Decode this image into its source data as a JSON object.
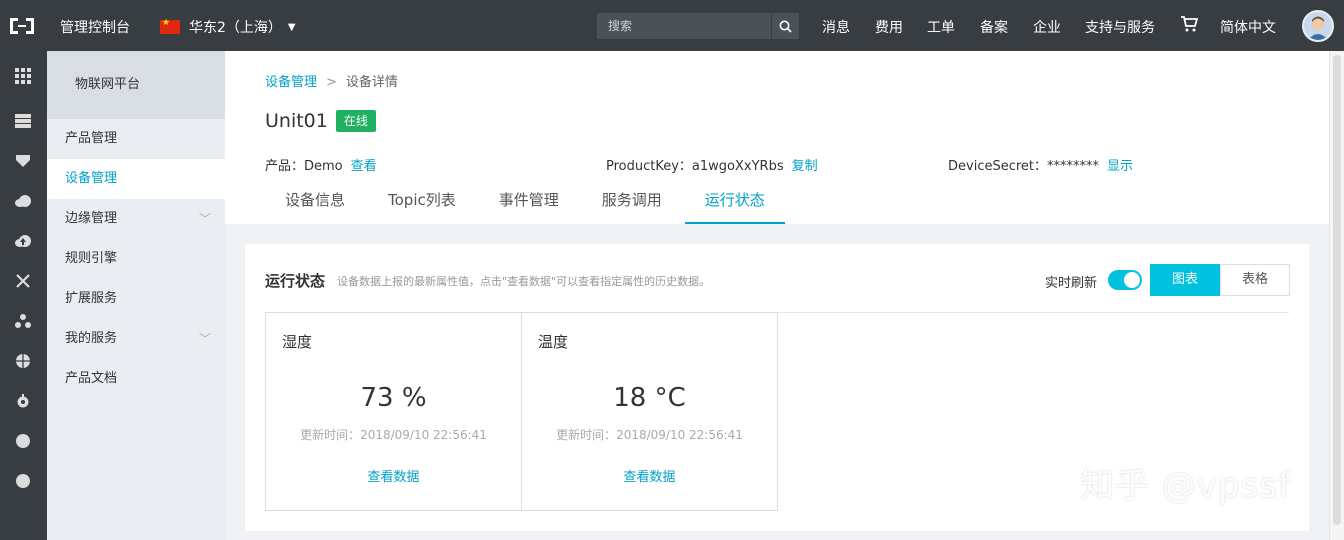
{
  "topbar": {
    "console_title": "管理控制台",
    "region": "华东2（上海）",
    "search_placeholder": "搜索",
    "nav": [
      "消息",
      "费用",
      "工单",
      "备案",
      "企业",
      "支持与服务"
    ],
    "language": "简体中文"
  },
  "iconbar": {
    "icons": [
      "grid-icon",
      "server-icon",
      "shield-icon",
      "cloud-icon",
      "cloud-upload-icon",
      "network-icon",
      "nodes-icon",
      "globe-icon",
      "gear-icon",
      "circle-icon",
      "circle-icon"
    ]
  },
  "sidebar": {
    "header": "物联网平台",
    "items": [
      {
        "label": "产品管理"
      },
      {
        "label": "设备管理"
      },
      {
        "label": "边缘管理"
      },
      {
        "label": "规则引擎"
      },
      {
        "label": "扩展服务"
      },
      {
        "label": "我的服务"
      },
      {
        "label": "产品文档"
      }
    ]
  },
  "breadcrumb": {
    "parent": "设备管理",
    "current": "设备详情"
  },
  "device": {
    "name": "Unit01",
    "status": "在线",
    "product_label": "产品：Demo",
    "product_link": "查看",
    "productkey_label": "ProductKey：a1wgoXxYRbs",
    "productkey_link": "复制",
    "secret_label": "DeviceSecret：********",
    "secret_link": "显示"
  },
  "tabs": [
    "设备信息",
    "Topic列表",
    "事件管理",
    "服务调用",
    "运行状态"
  ],
  "panel": {
    "title": "运行状态",
    "description": "设备数据上报的最新属性值，点击\"查看数据\"可以查看指定属性的历史数据。",
    "realtime_label": "实时刷新",
    "view_chart": "图表",
    "view_table": "表格",
    "cards": [
      {
        "name": "湿度",
        "value": "73 %",
        "time": "更新时间：2018/09/10 22:56:41",
        "link": "查看数据"
      },
      {
        "name": "温度",
        "value": "18 °C",
        "time": "更新时间：2018/09/10 22:56:41",
        "link": "查看数据"
      }
    ]
  },
  "watermark": "知乎 @vpssf",
  "colors": {
    "topbar": "#373d41",
    "accent": "#00a2ca",
    "toggle": "#00c1de",
    "online": "#1fb060"
  }
}
